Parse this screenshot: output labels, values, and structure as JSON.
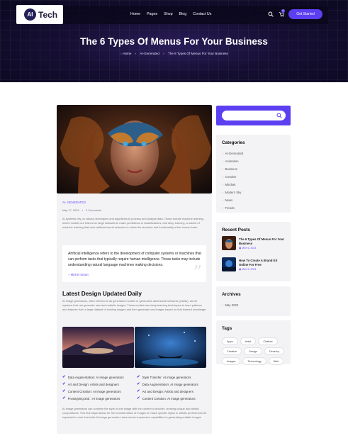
{
  "brand": {
    "logo_mark": "AI",
    "logo_text": "Tech"
  },
  "nav": {
    "links": [
      "Home",
      "Pages",
      "Shop",
      "Blog",
      "Contact Us"
    ],
    "cart_count": "0",
    "cta": "Get Started"
  },
  "hero": {
    "title": "The 6 Types Of Menus For Your Business",
    "breadcrumb": [
      "Home",
      "AI-Generated",
      "The 6 Types Of Menus For Your Business"
    ]
  },
  "article": {
    "category": "AI- GENERATED",
    "date": "May 17, 2023",
    "comments": "2 Comments",
    "intro": "AI systems rely on various techniques and algorithms to process and analyze data. These include machine learning, where models are trained on large datasets to make predictions or classifications, and deep learning, a subset of machine learning that uses artificial neural networks to mimic the structure and functionality of the human brain.",
    "quote": "Artificial intelligence refers to the development of computer systems or machines that can perform tasks that typically require human intelligence. These tasks may include understanding natural language machines making decisions.",
    "quote_author": "– Michel Smart",
    "heading": "Latest Design Updated Daily",
    "para2": "AI image generators, often referred to as generative models or generative adversarial networks (GANs), are AI systems that can generate new and realistic images. These models use deep learning techniques to learn patterns and features from a large dataset of existing images and then generate new images based on that learned knowledge.",
    "checks_left": [
      "Data Augmentation: AI image generators",
      "Art and Design: Artists and designers",
      "Content Creation: AI image generators",
      "Prototyping and : AI image generators"
    ],
    "checks_right": [
      "Style Transfer: AI image generators",
      "Data Augmentation: AI image generators",
      "Art and Design: Artists and designers",
      "Content Creation: AI image generators"
    ],
    "para3": "AI image generators can combine the style of one image with the content of another, creating unique and artistic compositions. This technique allows for the transformation of images to match specific styles or artistic preferences.It's important to note that while AI image generators have shown impressive capabilities in generating realistic images"
  },
  "sidebar": {
    "search_placeholder": "",
    "categories_title": "Categories",
    "categories": [
      "AI-Generated",
      "Animation",
      "Business",
      "Creative",
      "Mindset",
      "Modern Sky",
      "News",
      "Trends"
    ],
    "recent_title": "Recent Posts",
    "recent": [
      {
        "title": "The 6 Types Of Menus For Your Business",
        "date": "MAY 6, 2023"
      },
      {
        "title": "How To Create A Brand Kit Online For Free",
        "date": "MAY 6, 2023"
      }
    ],
    "archives_title": "Archives",
    "archives": [
      "May 2023"
    ],
    "tags_title": "Tags",
    "tags": [
      "Apps",
      "Artist",
      "Chatbot",
      "Creative",
      "Design",
      "Develop",
      "Images",
      "Technology",
      "Web"
    ]
  },
  "colors": {
    "accent": "#5b3ff0",
    "hero_bg": "#160f33",
    "card_bg": "#f3f3f5"
  },
  "icons": [
    "search-icon",
    "cart-icon",
    "home-icon",
    "chevron-right-icon",
    "check-icon",
    "calendar-icon",
    "quote-icon"
  ]
}
